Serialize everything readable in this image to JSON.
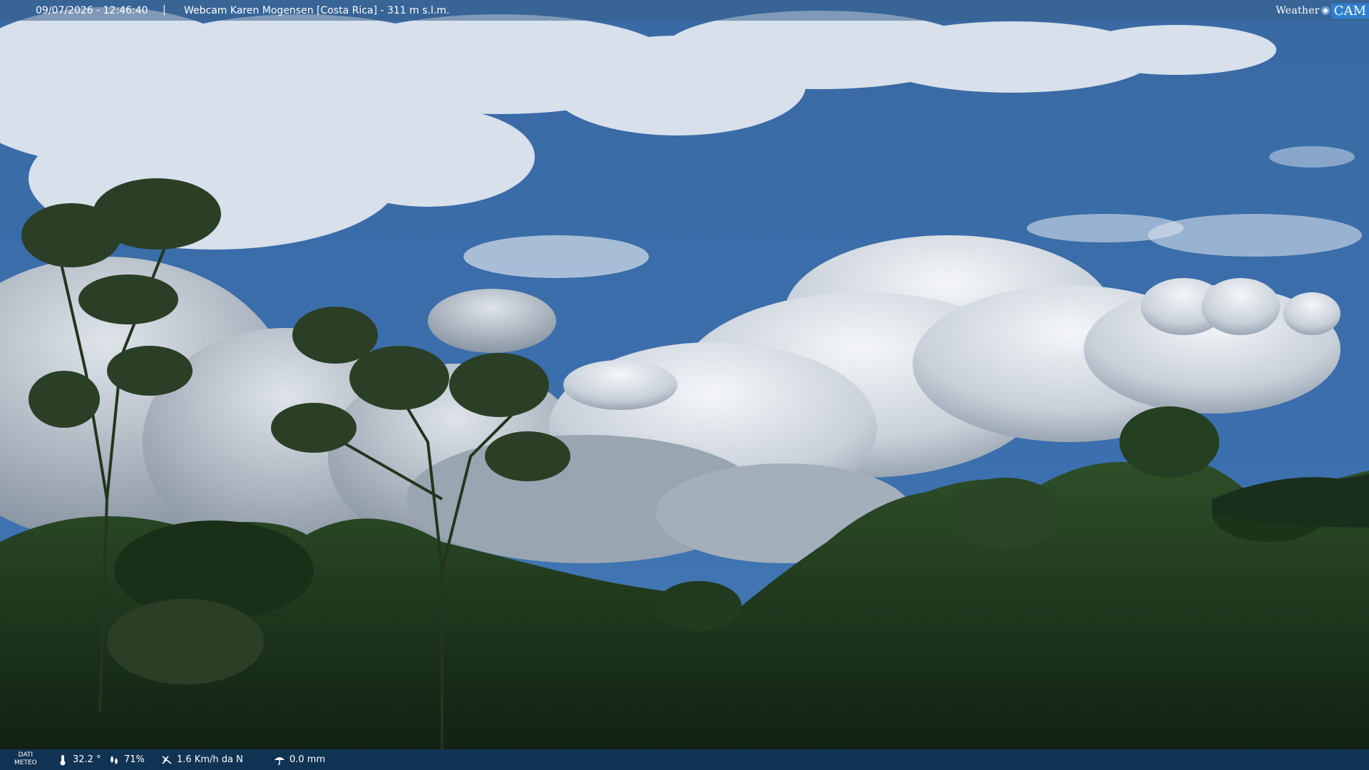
{
  "header": {
    "datetime": "09/07/2026 - 12:46:40",
    "separator": "|",
    "title": "Webcam Karen Mogensen [Costa Rica]  - 311 m s.l.m."
  },
  "logo": {
    "word": "Weather",
    "cam": "CAM"
  },
  "weather": {
    "label_line1": "DATI",
    "label_line2": "METEO",
    "temperature": "32.2 °",
    "humidity": "71%",
    "wind": "1.6 Km/h da N",
    "rain": "0.0 mm"
  },
  "colors": {
    "sky": "#2f5d92",
    "cloud": "#e9eef4",
    "forest_dark": "#142617",
    "forest_mid": "#2a4a24",
    "bar": "#12375f"
  }
}
